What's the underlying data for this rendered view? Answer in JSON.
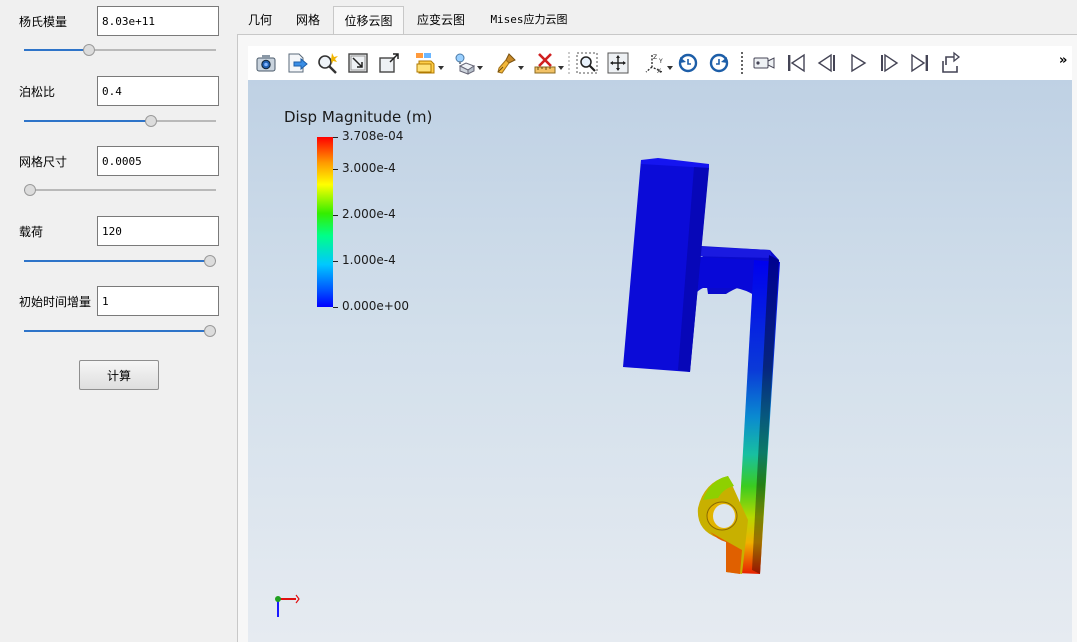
{
  "params": [
    {
      "label": "杨氏模量",
      "value": "8.03e+11",
      "slider_fraction": 0.33
    },
    {
      "label": "泊松比",
      "value": "0.4",
      "slider_fraction": 0.67
    },
    {
      "label": "网格尺寸",
      "value": "0.0005",
      "slider_fraction": 0.0
    },
    {
      "label": "载荷",
      "value": "120",
      "slider_fraction": 1.0
    },
    {
      "label": "初始时间增量",
      "value": "1",
      "slider_fraction": 1.0
    }
  ],
  "calc_button_label": "计算",
  "tabs": [
    {
      "label": "几何",
      "active": false
    },
    {
      "label": "网格",
      "active": false
    },
    {
      "label": "位移云图",
      "active": true
    },
    {
      "label": "应变云图",
      "active": false
    },
    {
      "label": "Mises应力云图",
      "active": false
    }
  ],
  "toolbar": {
    "icons": [
      "camera-icon",
      "export-icon",
      "query-icon",
      "zoom-box-icon",
      "zoom-to-fit-icon",
      "layers-icon",
      "light-icon",
      "paint-icon",
      "ruler-icon",
      "zoom-region-icon",
      "pan-icon",
      "axes-orientation-icon",
      "rotate-ccw-icon",
      "rotate-cw-icon",
      "video-camera-icon",
      "first-frame-icon",
      "previous-frame-icon",
      "play-icon",
      "next-frame-icon",
      "last-frame-icon",
      "loop-icon"
    ],
    "more_label": "»"
  },
  "legend": {
    "title": "Disp Magnitude (m)",
    "max_label": "3.708e-04",
    "labels": [
      "3.000e-4",
      "2.000e-4",
      "1.000e-4",
      "0.000e+00"
    ],
    "max_value": 0.0003708,
    "values": [
      0.0003,
      0.0002,
      0.0001,
      0.0
    ],
    "colors": [
      "#ff0000",
      "#ffff00",
      "#00ff00",
      "#00ffff",
      "#0000ff"
    ]
  },
  "colors": {
    "slider_accent": "#2e74c9",
    "viewport_top": "#bfd1e4",
    "viewport_bottom": "#e6ebf1",
    "model_low": "#0000ff",
    "model_high": "#ff0000"
  }
}
